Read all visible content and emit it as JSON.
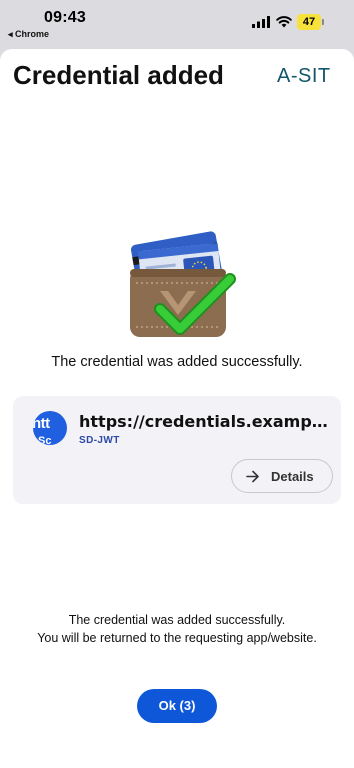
{
  "status_bar": {
    "time": "09:43",
    "back_app": "◂ Chrome",
    "battery": "47"
  },
  "header": {
    "title": "Credential added",
    "logo": "A-SIT"
  },
  "main": {
    "illustration": "wallet-with-checkmark",
    "success_message": "The credential was added successfully."
  },
  "credential_card": {
    "avatar_text": "ntt",
    "avatar_subtext": "Sc",
    "issuer": "https://credentials.example.com",
    "format": "SD-JWT",
    "details_label": "Details"
  },
  "footer": {
    "line1": "The credential was added successfully.",
    "line2": "You will be returned to the requesting app/website.",
    "ok_label": "Ok (3)"
  },
  "colors": {
    "accent": "#0d57d8",
    "logo": "#12566a",
    "card_bg": "#f3f2f7",
    "check": "#2ec22e"
  }
}
